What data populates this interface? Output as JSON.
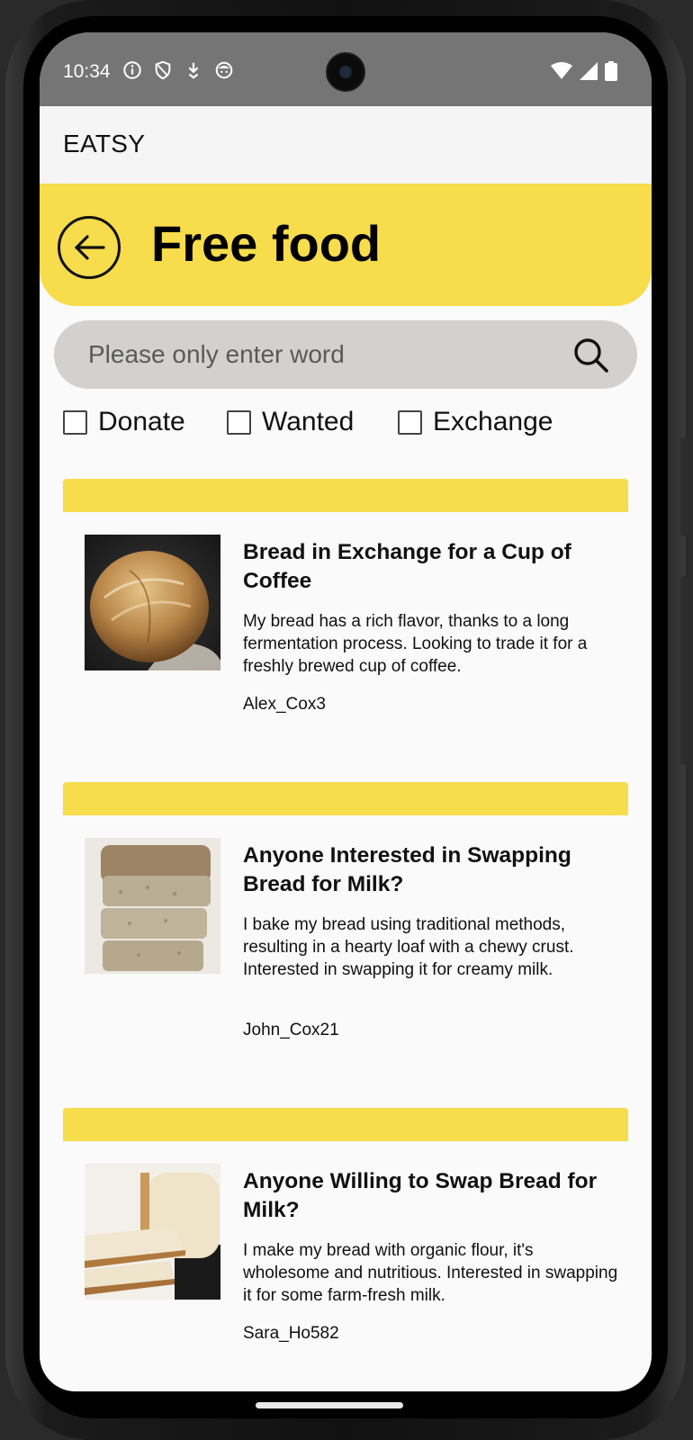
{
  "status_bar": {
    "time": "10:34",
    "left_icons": [
      "info-icon",
      "shield-icon",
      "download-icon",
      "face-icon"
    ],
    "right_icons": [
      "wifi-icon",
      "signal-icon",
      "battery-icon"
    ]
  },
  "app_bar": {
    "title": "EATSY"
  },
  "header": {
    "title": "Free food",
    "back_icon": "arrow-left-icon",
    "color": "#f7dc4c"
  },
  "search": {
    "placeholder": "Please only enter word",
    "value": ""
  },
  "filters": [
    {
      "label": "Donate",
      "checked": false
    },
    {
      "label": "Wanted",
      "checked": false
    },
    {
      "label": "Exchange",
      "checked": false
    }
  ],
  "posts": [
    {
      "title": " Bread in Exchange for a Cup of Coffee",
      "description": "My bread has a rich flavor, thanks to a long fermentation process. Looking to trade it for a freshly brewed cup of coffee.",
      "author": "Alex_Cox3"
    },
    {
      "title": "Anyone Interested in Swapping Bread for Milk?",
      "description": "I bake my bread using traditional methods, resulting in a hearty loaf with a chewy crust. Interested in swapping it for creamy milk.",
      "author": "John_Cox21"
    },
    {
      "title": "Anyone Willing to Swap Bread for Milk?",
      "description": "I make my bread with organic flour, it's wholesome and nutritious. Interested in swapping it for some farm-fresh milk.",
      "author": "Sara_Ho582"
    }
  ]
}
